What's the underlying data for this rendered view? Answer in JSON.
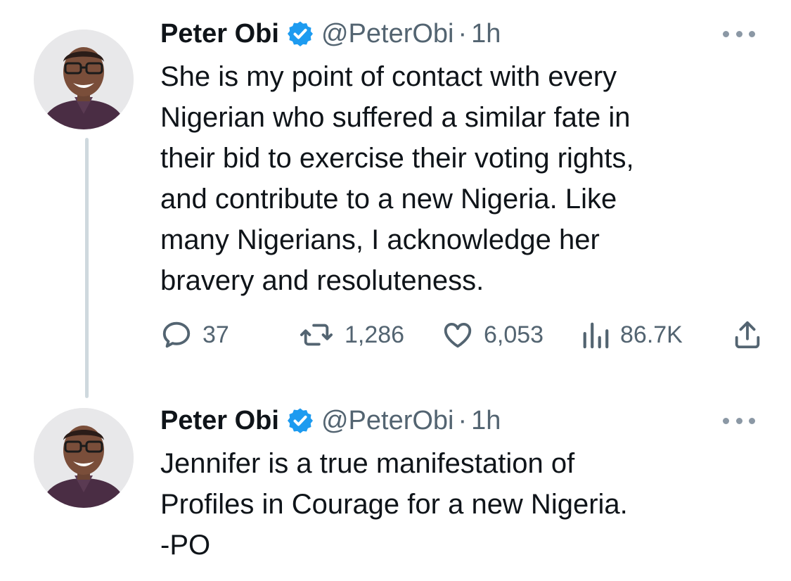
{
  "tweets": [
    {
      "author": {
        "name": "Peter Obi",
        "handle": "@PeterObi",
        "time": "1h",
        "verified": true
      },
      "text": "She is my point of contact with every\nNigerian who suffered a similar fate in\ntheir bid to exercise their voting rights,\nand contribute to a new Nigeria. Like\nmany Nigerians, I acknowledge her\nbravery and resoluteness.",
      "stats": {
        "replies": "37",
        "retweets": "1,286",
        "likes": "6,053",
        "views": "86.7K"
      }
    },
    {
      "author": {
        "name": "Peter Obi",
        "handle": "@PeterObi",
        "time": "1h",
        "verified": true
      },
      "text": "Jennifer is a true manifestation of\nProfiles in Courage for a new Nigeria.\n-PO"
    }
  ],
  "icons": {
    "reply": "speech-bubble-icon",
    "retweet": "retweet-arrows-icon",
    "like": "heart-icon",
    "views": "bar-chart-icon",
    "share": "share-upload-icon",
    "more": "more-dots-icon",
    "verified": "verified-badge-icon"
  },
  "colors": {
    "verified_blue": "#1d9bf0",
    "secondary_text": "#536471",
    "thread_line": "#cfd9de"
  }
}
